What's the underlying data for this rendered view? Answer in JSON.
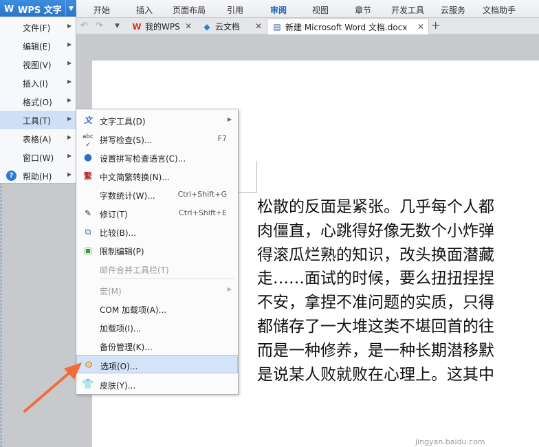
{
  "app": {
    "wps_button": "WPS 文字",
    "ribbon_tabs": [
      "开始",
      "插入",
      "页面布局",
      "引用",
      "审阅",
      "视图",
      "章节",
      "开发工具",
      "云服务",
      "文档助手"
    ]
  },
  "doc_tabs": [
    {
      "label": "我的WPS",
      "icon": "wps-logo-icon"
    },
    {
      "label": "云文档",
      "icon": "cloud-cube-icon"
    },
    {
      "label": "新建 Microsoft Word 文档.docx",
      "icon": "word-doc-icon"
    }
  ],
  "main_menu": [
    {
      "label": "文件(F)",
      "id": "file"
    },
    {
      "label": "编辑(E)",
      "id": "edit"
    },
    {
      "label": "视图(V)",
      "id": "view"
    },
    {
      "label": "插入(I)",
      "id": "insert"
    },
    {
      "label": "格式(O)",
      "id": "format"
    },
    {
      "label": "工具(T)",
      "id": "tools"
    },
    {
      "label": "表格(A)",
      "id": "table"
    },
    {
      "label": "窗口(W)",
      "id": "window"
    },
    {
      "label": "帮助(H)",
      "id": "help"
    }
  ],
  "tools_menu": {
    "text_tools": "文字工具(D)",
    "spell_check": "拼写检查(S)...",
    "spell_check_shortcut": "F7",
    "spell_language": "设置拼写检查语言(C)...",
    "chinese_convert": "中文简繁转换(N)...",
    "word_count": "字数统计(W)...",
    "word_count_shortcut": "Ctrl+Shift+G",
    "revise": "修订(T)",
    "revise_shortcut": "Ctrl+Shift+E",
    "compare": "比较(B)...",
    "restrict_edit": "限制编辑(P)",
    "mail_merge": "邮件合并工具栏(T)",
    "macro": "宏(M)",
    "com_addins": "COM 加载项(A)...",
    "addins": "加载项(I)...",
    "backup": "备份管理(K)...",
    "options": "选项(O)...",
    "skin": "皮肤(Y)..."
  },
  "document": {
    "lines": [
      "松散的反面是紧张。几乎每个人都",
      "肉僵直，心跳得好像无数个小炸弹",
      "得滚瓜烂熟的知识，改头换面潜藏",
      "走……面试的时候，要么扭扭捏捏",
      "不安，拿捏不准问题的实质，只得",
      "都储存了一大堆这类不堪回首的往",
      "而是一种修养，是一种长期潜移默",
      "是说某人败就败在心理上。这其中"
    ]
  },
  "watermark": "jingyan.baidu.com",
  "colors": {
    "wps_blue": "#2a73c7",
    "menu_highlight": "#d3e3f8",
    "arrow": "#f26b3a"
  }
}
